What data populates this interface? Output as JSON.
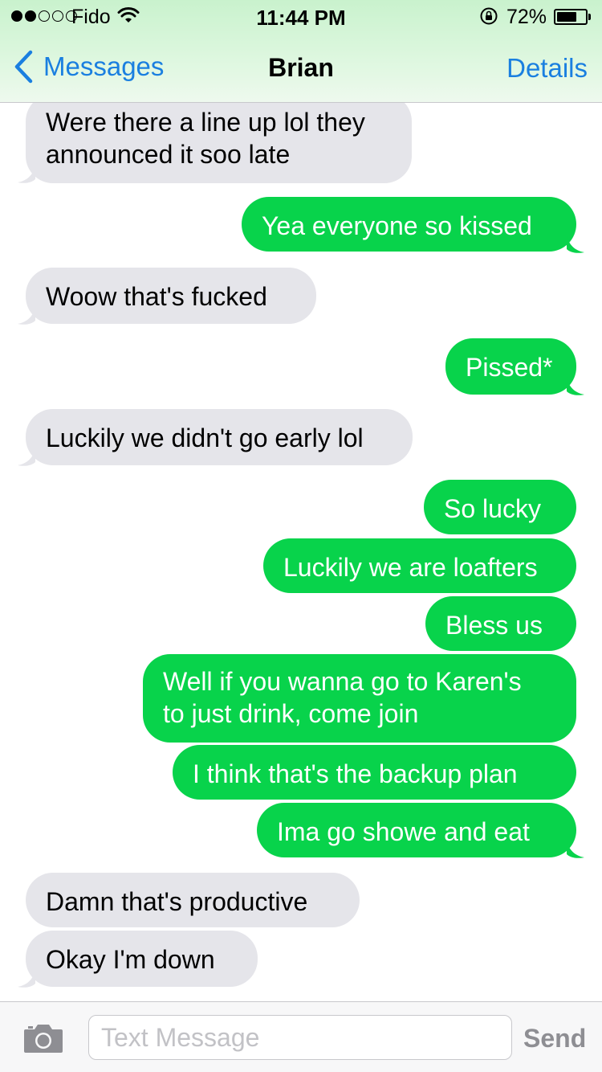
{
  "status_bar": {
    "signal_dots": [
      true,
      true,
      false,
      false,
      false
    ],
    "carrier": "Fido",
    "time": "11:44 PM",
    "battery_percent": "72%",
    "battery_level": 0.72,
    "icons": [
      "wifi-icon",
      "rotation-lock-icon",
      "battery-icon"
    ]
  },
  "nav": {
    "back_label": "Messages",
    "title": "Brian",
    "details_label": "Details"
  },
  "messages": [
    {
      "dir": "in",
      "text": "Were there a line up lol they\nannounced it soo late",
      "tail": true
    },
    {
      "dir": "out",
      "text": "Yea everyone so kissed",
      "tail": true
    },
    {
      "dir": "in",
      "text": "Woow that's fucked",
      "tail": true
    },
    {
      "dir": "out",
      "text": "Pissed*",
      "tail": true
    },
    {
      "dir": "in",
      "text": "Luckily we didn't go early lol",
      "tail": true
    },
    {
      "dir": "out",
      "text": "So lucky",
      "tail": false
    },
    {
      "dir": "out",
      "text": "Luckily we are loafters",
      "tail": false
    },
    {
      "dir": "out",
      "text": "Bless us",
      "tail": false
    },
    {
      "dir": "out",
      "text": "Well if you wanna go to Karen's\nto just drink, come join",
      "tail": false
    },
    {
      "dir": "out",
      "text": "I think that's the backup plan",
      "tail": false
    },
    {
      "dir": "out",
      "text": "Ima go showe and eat",
      "tail": true
    },
    {
      "dir": "in",
      "text": "Damn that's productive",
      "tail": false
    },
    {
      "dir": "in",
      "text": "Okay I'm down",
      "tail": true
    }
  ],
  "input": {
    "placeholder": "Text Message",
    "value": "",
    "send_label": "Send"
  },
  "colors": {
    "incoming_bubble": "#e5e5ea",
    "outgoing_bubble": "#08d34b",
    "link_blue": "#1a7fe0"
  }
}
